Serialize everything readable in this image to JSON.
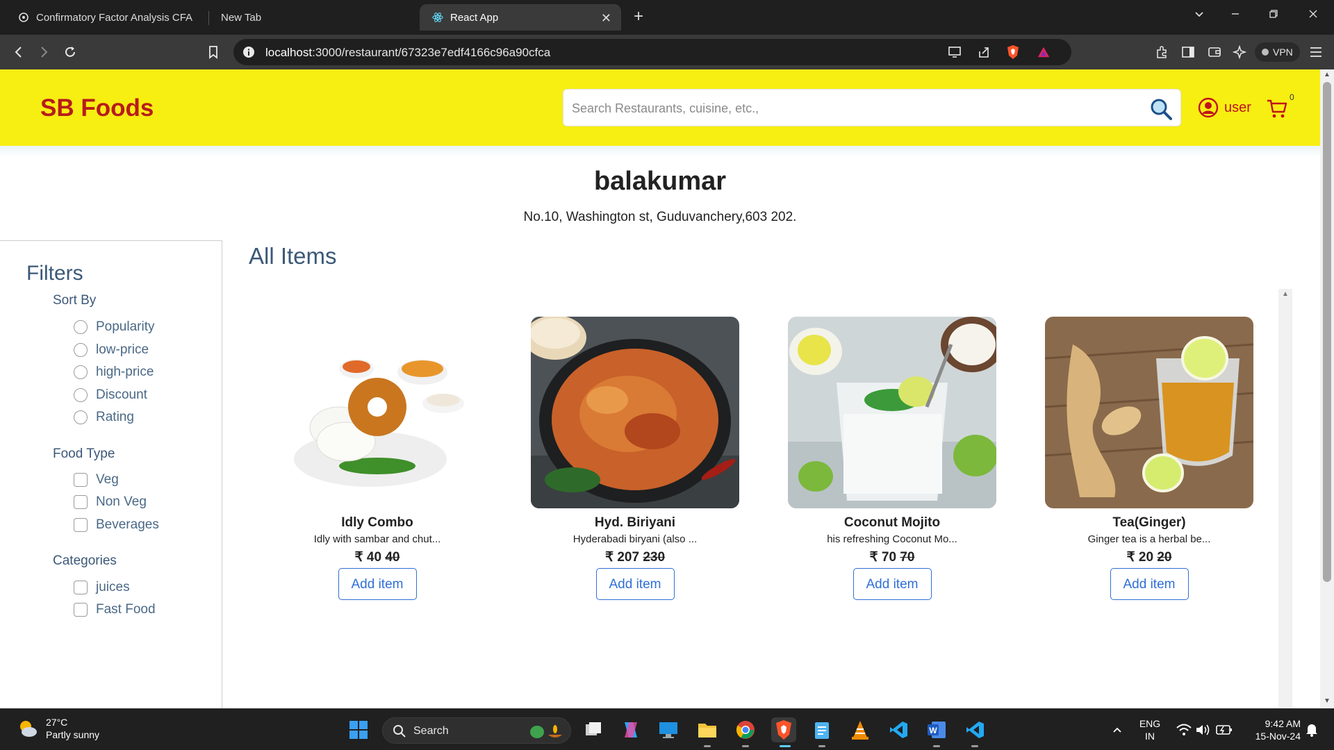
{
  "browser": {
    "tabs": [
      {
        "title": "Confirmatory Factor Analysis CFA"
      },
      {
        "title": "New Tab"
      },
      {
        "title": "React App"
      }
    ],
    "url_host": "localhost",
    "url_rest": ":3000/restaurant/67323e7edf4166c96a90cfca",
    "vpn_label": "VPN"
  },
  "header": {
    "brand": "SB Foods",
    "search_placeholder": "Search Restaurants, cuisine, etc.,",
    "user_label": "user",
    "cart_count": "0"
  },
  "restaurant": {
    "name": "balakumar",
    "address": "No.10, Washington st, Guduvanchery,603 202."
  },
  "filters": {
    "title": "Filters",
    "sort_by": {
      "label": "Sort By",
      "options": [
        "Popularity",
        "low-price",
        "high-price",
        "Discount",
        "Rating"
      ]
    },
    "food_type": {
      "label": "Food Type",
      "options": [
        "Veg",
        "Non Veg",
        "Beverages"
      ]
    },
    "categories": {
      "label": "Categories",
      "options": [
        "juices",
        "Fast Food"
      ]
    }
  },
  "items": {
    "title": "All Items",
    "list": [
      {
        "name": "Idly Combo",
        "desc": "Idly with sambar and chut...",
        "price": "₹ 40",
        "old_price": "40",
        "button": "Add item"
      },
      {
        "name": "Hyd. Biriyani",
        "desc": "Hyderabadi biryani (also ...",
        "price": "₹ 207",
        "old_price": "230",
        "button": "Add item"
      },
      {
        "name": "Coconut Mojito",
        "desc": "his refreshing Coconut Mo...",
        "price": "₹ 70",
        "old_price": "70",
        "button": "Add item"
      },
      {
        "name": "Tea(Ginger)",
        "desc": "Ginger tea is a herbal be...",
        "price": "₹ 20",
        "old_price": "20",
        "button": "Add item"
      }
    ]
  },
  "taskbar": {
    "weather_temp": "27°C",
    "weather_desc": "Partly sunny",
    "search_label": "Search",
    "lang_1": "ENG",
    "lang_2": "IN",
    "time": "9:42 AM",
    "date": "15-Nov-24"
  },
  "colors": {
    "header_bg": "#f7ee12",
    "brand": "#b71c1c",
    "accent_blue": "#2f6fd6",
    "filter_text": "#3b5878"
  }
}
